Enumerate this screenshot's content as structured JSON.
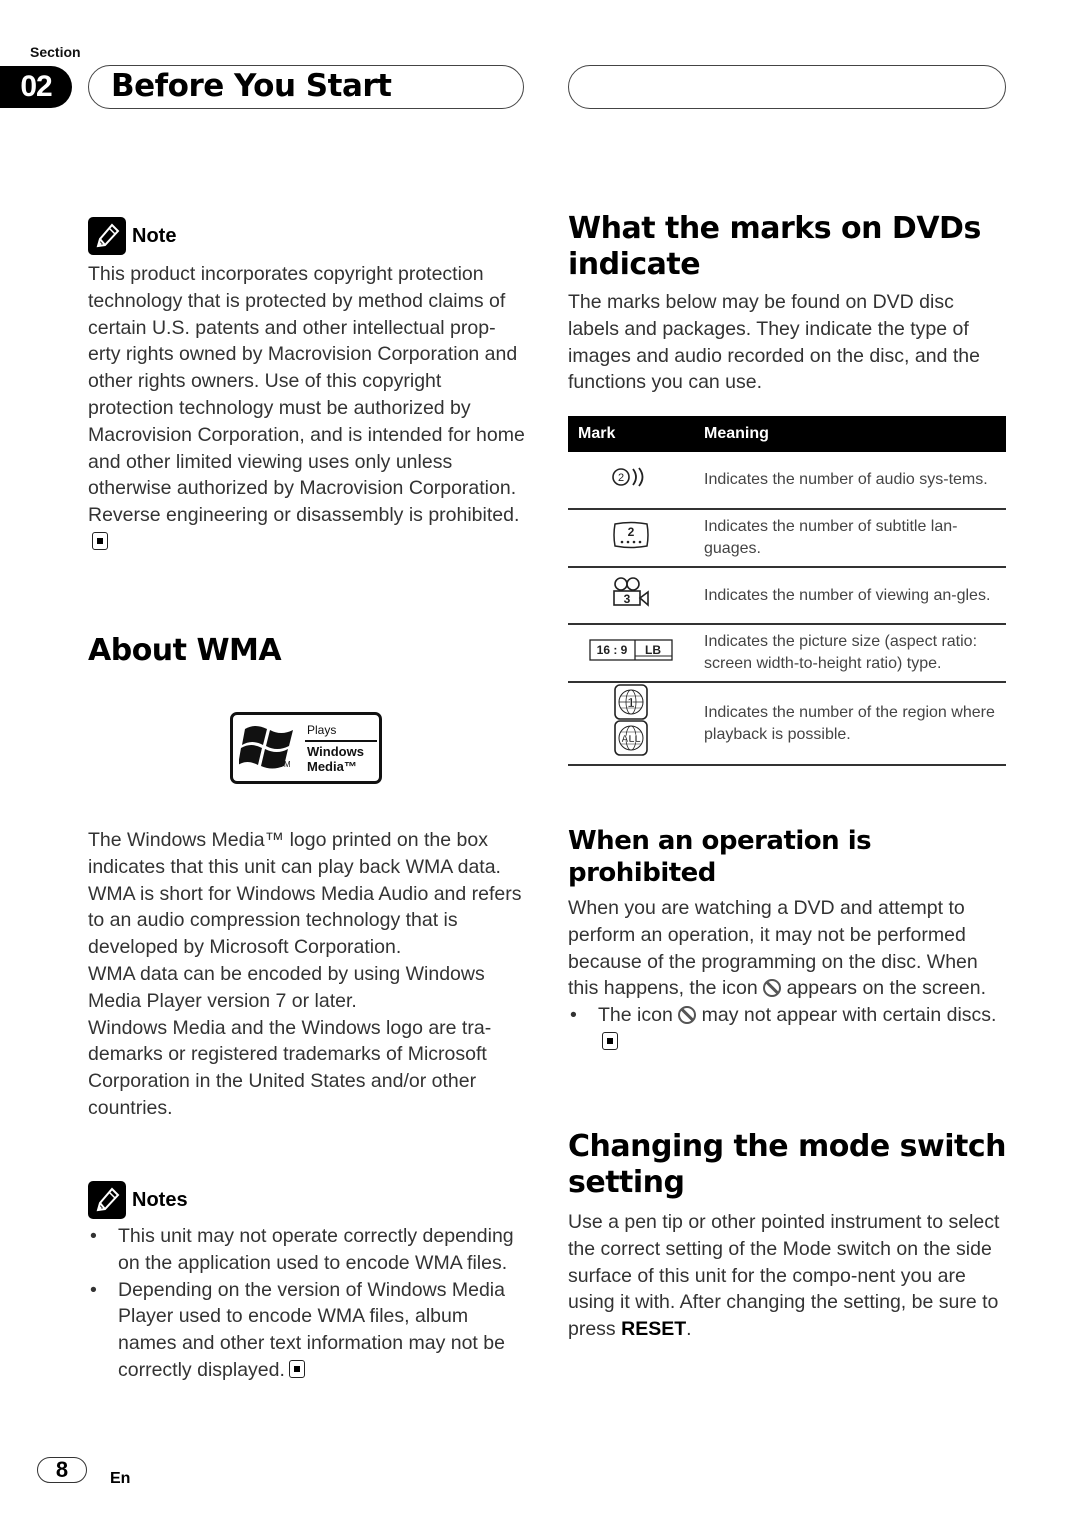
{
  "header": {
    "section_label": "Section",
    "section_number": "02",
    "title": "Before You Start"
  },
  "note1": {
    "label": "Note",
    "text": "This product incorporates copyright protection technology that is protected by method claims of certain U.S. patents and other intellectual prop-erty rights owned by Macrovision Corporation and other rights owners. Use of this copyright protection technology must be authorized by Macrovision Corporation, and is intended for home and other limited viewing uses only unless otherwise authorized by Macrovision Corporation. Reverse engineering or disassembly is prohibited."
  },
  "about_wma": {
    "heading": "About WMA",
    "logo": {
      "line1": "Plays",
      "line2": "Windows",
      "line3": "Media™",
      "tm": "TM"
    },
    "paragraphs": [
      "The Windows Media™ logo printed on the box indicates that this unit can play back WMA data.",
      "WMA is short for Windows Media Audio and refers to an audio compression technology that is developed by Microsoft Corporation.",
      "WMA data can be encoded by using Windows Media Player version 7 or later.",
      "Windows Media and the Windows logo are tra-demarks or registered trademarks of Microsoft Corporation in the United States and/or other countries."
    ]
  },
  "notes2": {
    "label": "Notes",
    "items": [
      "This unit may not operate correctly depending on the application used to encode WMA files.",
      "Depending on the version of Windows Media Player used to encode WMA files, album names and other text information may not be correctly displayed."
    ]
  },
  "dvd_marks": {
    "heading": "What the marks on DVDs indicate",
    "intro": "The marks below may be found on DVD disc labels and packages. They indicate the type of images and audio recorded on the disc, and the functions you can use.",
    "table": {
      "headers": [
        "Mark",
        "Meaning"
      ],
      "rows": [
        {
          "icon": "audio-systems-icon",
          "mark_text": "2",
          "meaning": "Indicates the number of audio sys-tems."
        },
        {
          "icon": "subtitle-languages-icon",
          "mark_text": "2",
          "meaning": "Indicates the number of subtitle lan-guages."
        },
        {
          "icon": "viewing-angles-icon",
          "mark_text": "3",
          "meaning": "Indicates the number of viewing an-gles."
        },
        {
          "icon": "aspect-ratio-icon",
          "mark_text": "16 : 9",
          "mark_text2": "LB",
          "meaning": "Indicates the picture size (aspect ratio: screen width-to-height ratio) type."
        },
        {
          "icon": "region-icon",
          "mark_text": "1",
          "mark_text2": "ALL",
          "meaning": "Indicates the number of the region where playback is possible."
        }
      ]
    }
  },
  "prohibited": {
    "heading": "When an operation is prohibited",
    "text_before_icon": "When you are watching a DVD and attempt to perform an operation, it may not be performed because of the programming on the disc. When this happens, the icon",
    "text_after_icon": "appears on the screen.",
    "bullet_before_icon": "The icon",
    "bullet_after_icon": "may not appear with certain discs."
  },
  "mode_switch": {
    "heading": "Changing the mode switch setting",
    "text": "Use a pen tip or other pointed instrument to select the correct setting of the Mode switch on the side surface of this unit for the compo-nent you are using it with. After changing the setting, be sure to press",
    "bold": "RESET",
    "text_end": "."
  },
  "footer": {
    "page_number": "8",
    "language": "En"
  }
}
